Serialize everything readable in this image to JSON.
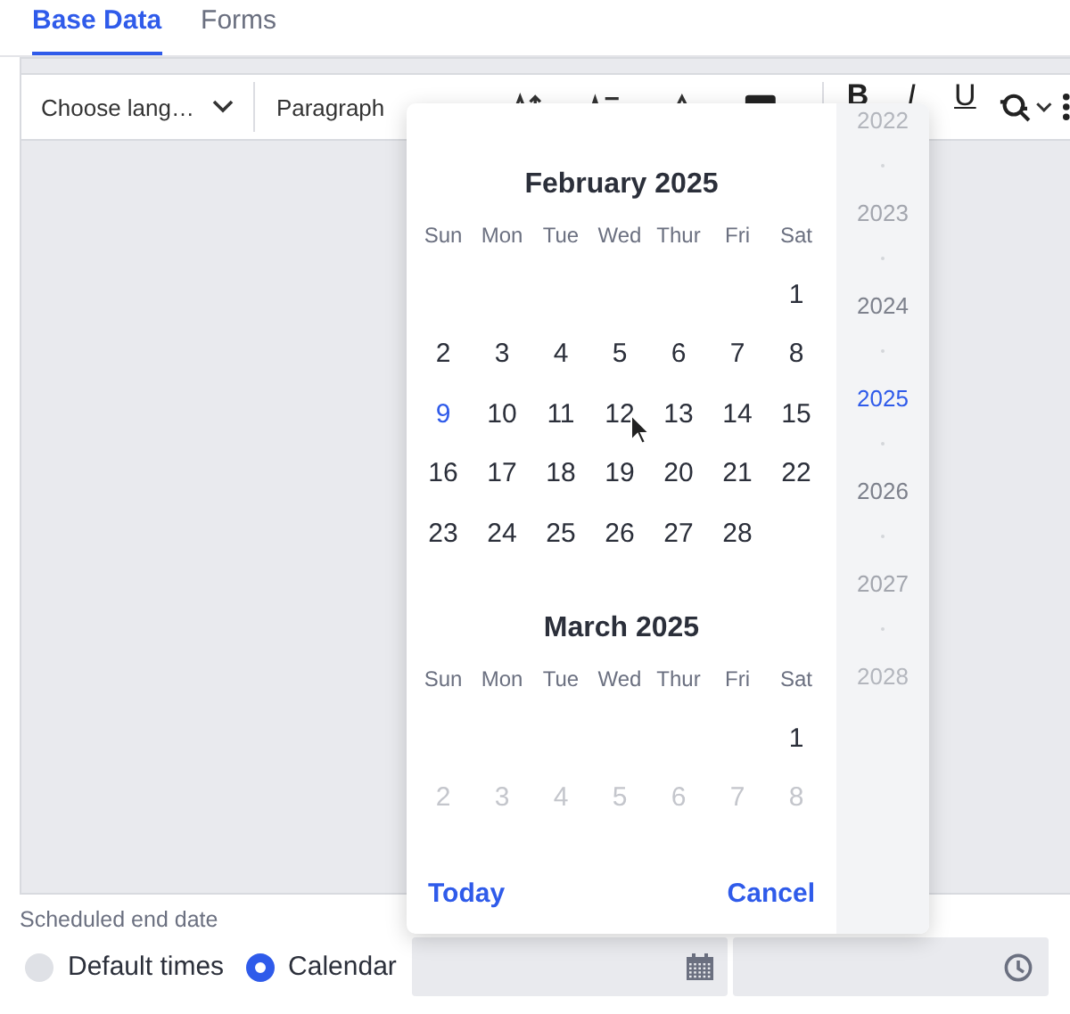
{
  "tabs": [
    {
      "label": "Base Data",
      "selected": true
    },
    {
      "label": "Forms",
      "selected": false
    }
  ],
  "toolbar": {
    "language": "Choose lang…",
    "block_style": "Paragraph",
    "format_buttons": [
      {
        "label": "B",
        "kind": "bold"
      },
      {
        "label": "I",
        "kind": "italic"
      },
      {
        "label": "U",
        "kind": "underline"
      }
    ]
  },
  "date_picker": {
    "months": [
      {
        "title": "February 2025",
        "weekdays": [
          "Sun",
          "Mon",
          "Tue",
          "Wed",
          "Thur",
          "Fri",
          "Sat"
        ],
        "weeks": [
          [
            {
              "kind": "blank"
            },
            {
              "kind": "blank"
            },
            {
              "kind": "blank"
            },
            {
              "kind": "blank"
            },
            {
              "kind": "blank"
            },
            {
              "kind": "blank"
            },
            {
              "day": "1",
              "kind": "regular"
            }
          ],
          [
            {
              "day": "2",
              "kind": "regular"
            },
            {
              "day": "3",
              "kind": "regular"
            },
            {
              "day": "4",
              "kind": "regular"
            },
            {
              "day": "5",
              "kind": "regular"
            },
            {
              "day": "6",
              "kind": "regular"
            },
            {
              "day": "7",
              "kind": "regular"
            },
            {
              "day": "8",
              "kind": "regular"
            }
          ],
          [
            {
              "day": "9",
              "kind": "today"
            },
            {
              "day": "10",
              "kind": "regular"
            },
            {
              "day": "11",
              "kind": "regular"
            },
            {
              "day": "12",
              "kind": "regular"
            },
            {
              "day": "13",
              "kind": "regular"
            },
            {
              "day": "14",
              "kind": "regular"
            },
            {
              "day": "15",
              "kind": "regular"
            }
          ],
          [
            {
              "day": "16",
              "kind": "regular"
            },
            {
              "day": "17",
              "kind": "regular"
            },
            {
              "day": "18",
              "kind": "regular"
            },
            {
              "day": "19",
              "kind": "regular"
            },
            {
              "day": "20",
              "kind": "regular"
            },
            {
              "day": "21",
              "kind": "regular"
            },
            {
              "day": "22",
              "kind": "regular"
            }
          ],
          [
            {
              "day": "23",
              "kind": "regular"
            },
            {
              "day": "24",
              "kind": "regular"
            },
            {
              "day": "25",
              "kind": "regular"
            },
            {
              "day": "26",
              "kind": "regular"
            },
            {
              "day": "27",
              "kind": "regular"
            },
            {
              "day": "28",
              "kind": "regular"
            },
            {
              "kind": "blank"
            }
          ]
        ]
      },
      {
        "title": "March 2025",
        "weekdays": [
          "Sun",
          "Mon",
          "Tue",
          "Wed",
          "Thur",
          "Fri",
          "Sat"
        ],
        "weeks": [
          [
            {
              "kind": "blank"
            },
            {
              "kind": "blank"
            },
            {
              "kind": "blank"
            },
            {
              "kind": "blank"
            },
            {
              "kind": "blank"
            },
            {
              "kind": "blank"
            },
            {
              "day": "1",
              "kind": "regular"
            }
          ],
          [
            {
              "day": "2",
              "kind": "faded"
            },
            {
              "day": "3",
              "kind": "faded"
            },
            {
              "day": "4",
              "kind": "faded"
            },
            {
              "day": "5",
              "kind": "faded"
            },
            {
              "day": "6",
              "kind": "faded"
            },
            {
              "day": "7",
              "kind": "faded"
            },
            {
              "day": "8",
              "kind": "faded"
            }
          ]
        ]
      }
    ],
    "years": [
      {
        "label": "2022",
        "selected": false
      },
      {
        "label": "2023",
        "selected": false
      },
      {
        "label": "2024",
        "selected": false
      },
      {
        "label": "2025",
        "selected": true
      },
      {
        "label": "2026",
        "selected": false
      },
      {
        "label": "2027",
        "selected": false
      },
      {
        "label": "2028",
        "selected": false
      }
    ],
    "actions": [
      "Today",
      "Cancel"
    ]
  },
  "end_date": {
    "label": "Scheduled end date",
    "options": [
      {
        "label": "Default times",
        "selected": false
      },
      {
        "label": "Calendar",
        "selected": true
      }
    ]
  }
}
